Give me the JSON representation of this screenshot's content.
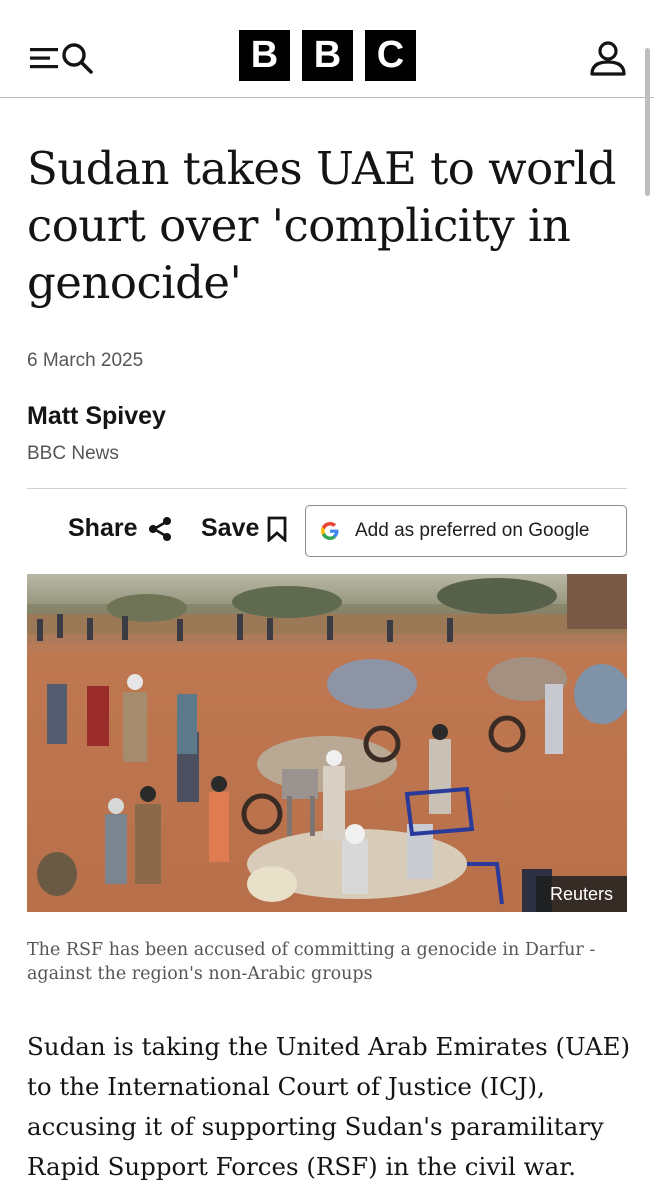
{
  "header": {
    "logo_letters": [
      "B",
      "B",
      "C"
    ],
    "menu_icon": "menu-icon",
    "search_icon": "search-icon",
    "account_icon": "account-icon"
  },
  "article": {
    "headline": "Sudan takes UAE to world court over 'complicity in genocide'",
    "date": "6 March 2025",
    "author": "Matt Spivey",
    "source": "BBC News"
  },
  "actions": {
    "share_label": "Share",
    "save_label": "Save",
    "google_label": "Add as preferred on Google"
  },
  "image": {
    "credit": "Reuters",
    "caption": "The RSF has been accused of committing a genocide in Darfur - against the region's non-Arabic groups"
  },
  "body": {
    "paragraph_1": "Sudan is taking the United Arab Emirates (UAE) to the International Court of Justice (ICJ), accusing it of supporting Sudan's paramilitary Rapid Support Forces (RSF) in the civil war."
  },
  "colors": {
    "text": "#141414",
    "meta": "#545658",
    "logo_bg": "#000000"
  }
}
